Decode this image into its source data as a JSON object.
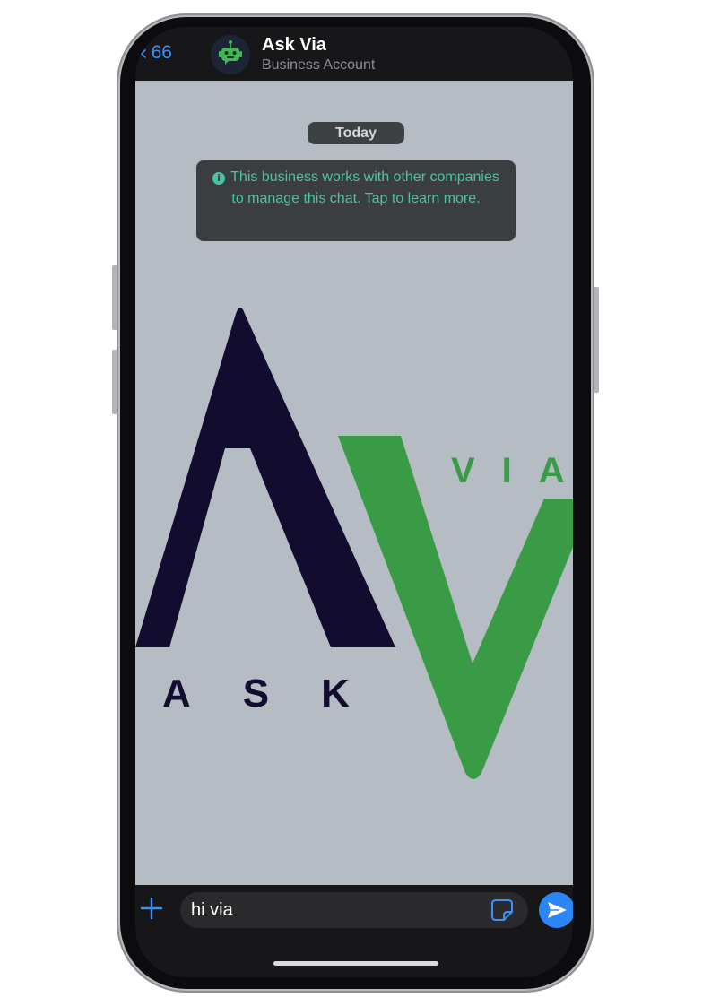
{
  "header": {
    "back_count": "66",
    "title": "Ask Via",
    "subtitle": "Business Account"
  },
  "chat": {
    "date_label": "Today",
    "notice_text": "This business works with other companies to manage this chat. Tap to learn more.",
    "logo": {
      "top_text": "VIA",
      "bottom_text": "ASK",
      "colors": {
        "dark": "#120c2e",
        "green": "#3a9b46"
      }
    }
  },
  "input": {
    "value": "hi via"
  },
  "icons": {
    "back": "chevron-left-icon",
    "avatar": "robot-icon",
    "info": "info-icon",
    "plus": "plus-icon",
    "sticker": "sticker-icon",
    "send": "send-icon"
  },
  "colors": {
    "accent": "#3f8ff7",
    "notice_text": "#4ec3a3",
    "chat_background": "#b5bcc4",
    "send_button": "#2c86f5"
  }
}
